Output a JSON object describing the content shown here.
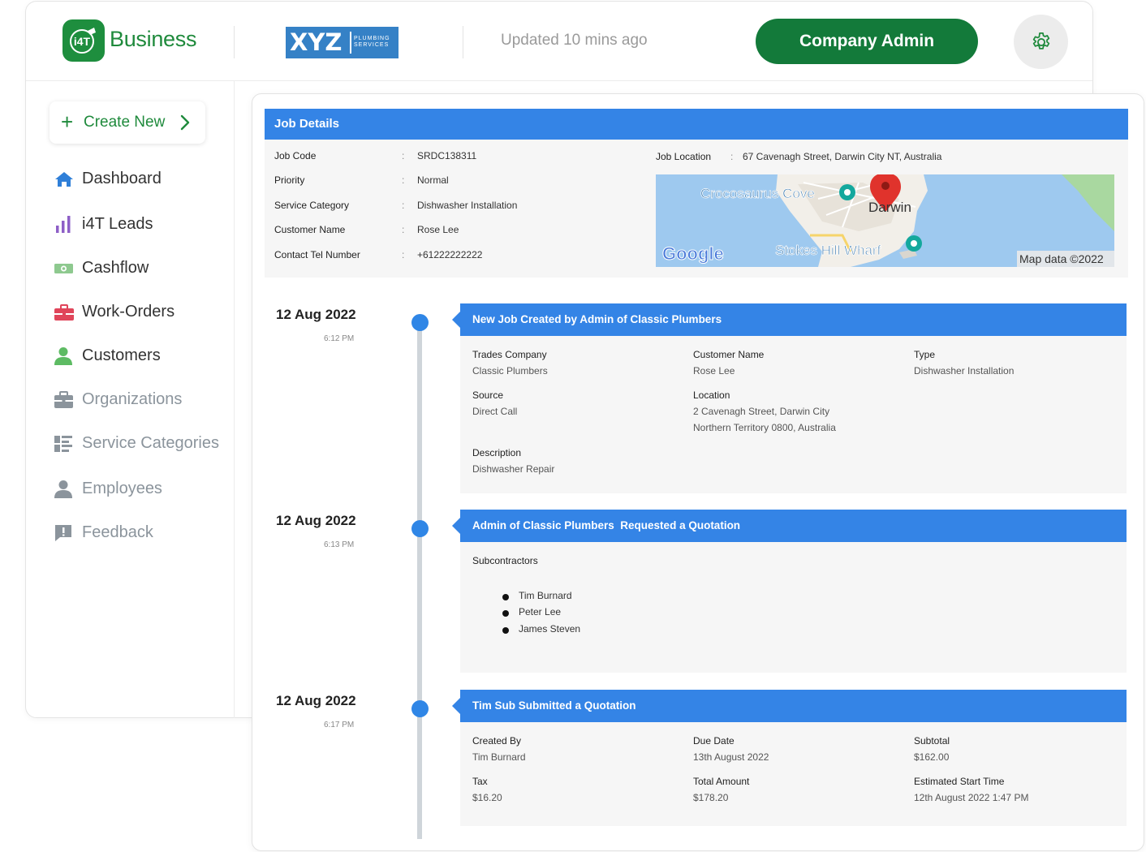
{
  "header": {
    "brand": "Business",
    "logo_text": "i4T",
    "company_logo": {
      "main": "XYZ",
      "sub_line1": "PLUMBING",
      "sub_line2": "SERVICES"
    },
    "updated": "Updated 10 mins ago",
    "admin_button": "Company Admin",
    "settings_icon": "gear-icon",
    "brand_color": "#1f8a3c",
    "admin_button_color": "#137a3a"
  },
  "sidebar": {
    "create_new": "Create New",
    "items": [
      {
        "label": "Dashboard",
        "icon": "home-icon",
        "active": true
      },
      {
        "label": "i4T Leads",
        "icon": "bar-chart-icon",
        "active": true
      },
      {
        "label": "Cashflow",
        "icon": "money-icon",
        "active": true
      },
      {
        "label": "Work-Orders",
        "icon": "toolbox-icon",
        "active": true
      },
      {
        "label": "Customers",
        "icon": "user-icon",
        "active": true
      },
      {
        "label": "Organizations",
        "icon": "briefcase-icon",
        "active": false
      },
      {
        "label": "Service Categories",
        "icon": "category-list-icon",
        "active": false
      },
      {
        "label": "Employees",
        "icon": "user-icon",
        "active": false
      },
      {
        "label": "Feedback",
        "icon": "feedback-icon",
        "active": false
      }
    ]
  },
  "job": {
    "title": "Job Details",
    "fields": [
      {
        "label": "Job Code",
        "value": "SRDC138311"
      },
      {
        "label": "Priority",
        "value": "Normal"
      },
      {
        "label": "Service Category",
        "value": "Dishwasher Installation"
      },
      {
        "label": "Customer Name",
        "value": "Rose Lee"
      },
      {
        "label": "Contact Tel Number",
        "value": "+61222222222"
      }
    ],
    "separator": ":",
    "location_label": "Job Location",
    "location_value": "67 Cavenagh Street, Darwin City NT, Australia",
    "map": {
      "labels": [
        "Crocosaurus Cove",
        "Darwin",
        "Stokes Hill Wharf"
      ],
      "google": "Google",
      "attribution": "Map data ©2022"
    }
  },
  "timeline": [
    {
      "date": "12 Aug 2022",
      "time": "6:12 PM",
      "title": "New Job Created by Admin of Classic Plumbers",
      "fields": [
        {
          "label": "Trades Company",
          "value": "Classic Plumbers"
        },
        {
          "label": "Customer Name",
          "value": "Rose Lee"
        },
        {
          "label": "Type",
          "value": "Dishwasher Installation"
        },
        {
          "label": "Source",
          "value": "Direct Call"
        },
        {
          "label": "Location",
          "value": "2 Cavenagh Street, Darwin City",
          "value2": "Northern Territory 0800, Australia"
        },
        {
          "label": "Description",
          "value": "Dishwasher Repair"
        }
      ]
    },
    {
      "date": "12 Aug 2022",
      "time": "6:13 PM",
      "title": "Admin of Classic Plumbers  Requested a Quotation",
      "subcontractors_label": "Subcontractors",
      "subcontractors": [
        "Tim Burnard",
        "Peter Lee",
        "James Steven"
      ]
    },
    {
      "date": "12 Aug 2022",
      "time": "6:17 PM",
      "title": "Tim Sub Submitted a Quotation",
      "fields": [
        {
          "label": "Created By",
          "value": "Tim Burnard"
        },
        {
          "label": "Due Date",
          "value": "13th August 2022"
        },
        {
          "label": "Subtotal",
          "value": "$162.00"
        },
        {
          "label": "Tax",
          "value": "$16.20"
        },
        {
          "label": "Total Amount",
          "value": "$178.20"
        },
        {
          "label": "Estimated Start Time",
          "value": "12th August 2022 1:47 PM"
        }
      ]
    }
  ],
  "colors": {
    "accent_blue": "#3484e6",
    "timeline_dot": "#2f86e6"
  }
}
